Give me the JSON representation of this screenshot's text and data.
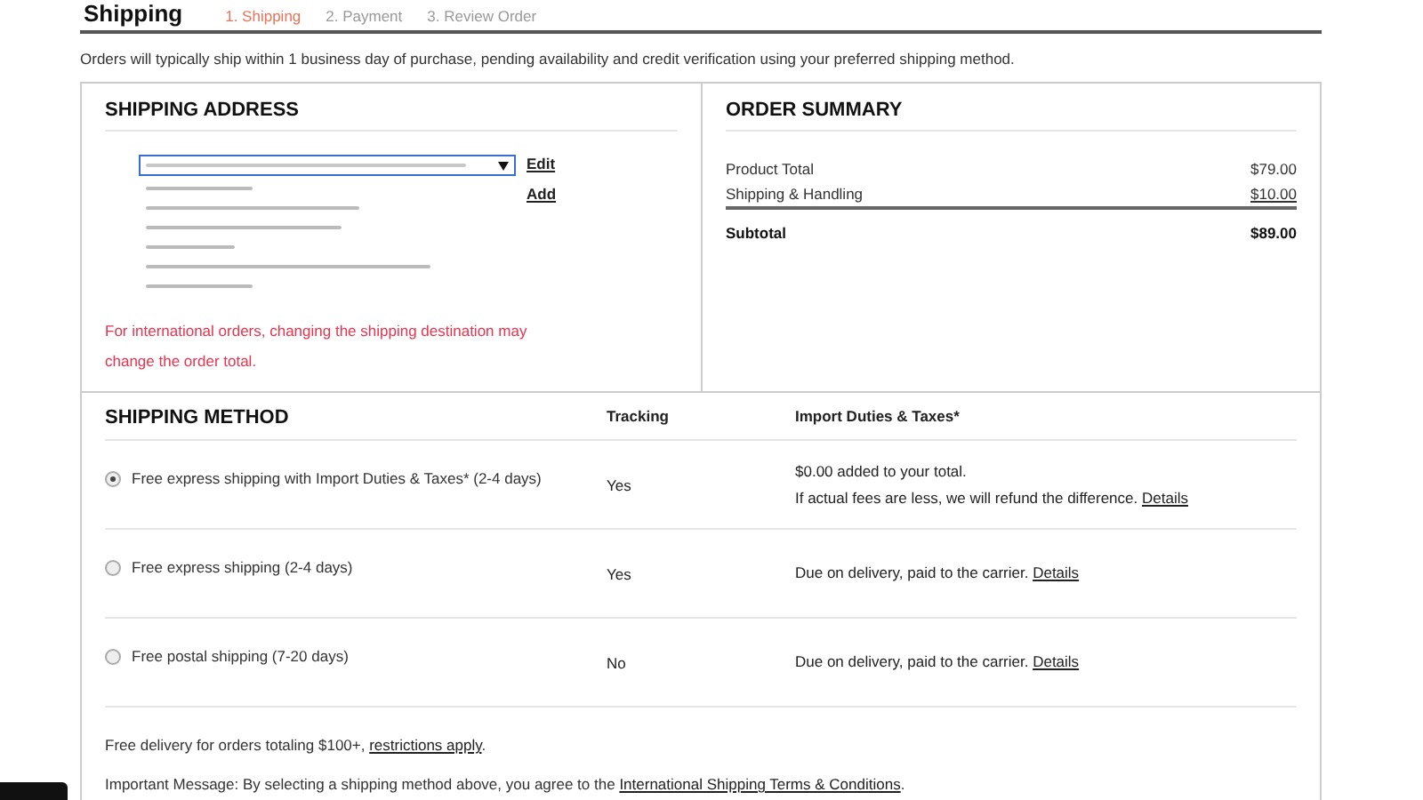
{
  "header": {
    "title": "Shipping",
    "steps": [
      {
        "label": "1. Shipping",
        "selected": true
      },
      {
        "label": "2. Payment",
        "selected": false
      },
      {
        "label": "3. Review Order",
        "selected": false
      }
    ]
  },
  "intro": "Orders will typically ship within 1 business day of purchase, pending availability and credit verification using your preferred shipping method.",
  "shipping_address": {
    "title": "SHIPPING ADDRESS",
    "links": [
      "Edit",
      "Add"
    ],
    "notice": "For international orders, changing the shipping destination may change the order total."
  },
  "order_summary": {
    "title": "ORDER SUMMARY",
    "lines": [
      {
        "label": "Product Total",
        "amount": "$79.00"
      },
      {
        "label": "Shipping & Handling",
        "amount": "$10.00"
      }
    ],
    "subtotal": {
      "label": "Subtotal",
      "amount": "$89.00"
    }
  },
  "shipping_method": {
    "title": "SHIPPING METHOD",
    "columns": [
      "Tracking",
      "Import Duties & Taxes*"
    ],
    "options": [
      {
        "label": "Free express shipping with Import Duties & Taxes* (2-4 days)",
        "selected": true,
        "tracking": "Yes",
        "duties": [
          "$0.00 added to your total.",
          "If actual fees are less, we will refund the difference."
        ],
        "link": "Details"
      },
      {
        "label": "Free express shipping (2-4 days)",
        "selected": false,
        "tracking": "Yes",
        "duties": [
          "Due on delivery, paid to the carrier."
        ],
        "link": "Details"
      },
      {
        "label": "Free postal shipping (7-20 days)",
        "selected": false,
        "tracking": "No",
        "duties": [
          "Due on delivery, paid to the carrier."
        ],
        "link": "Details"
      }
    ]
  },
  "notes": [
    {
      "text": "Free delivery for orders totaling $100+, ",
      "link": "restrictions apply",
      "end": "."
    },
    {
      "text": "Important Message: By selecting a shipping method above, you agree to the ",
      "link": "International Shipping Terms & Conditions",
      "end": "."
    }
  ]
}
